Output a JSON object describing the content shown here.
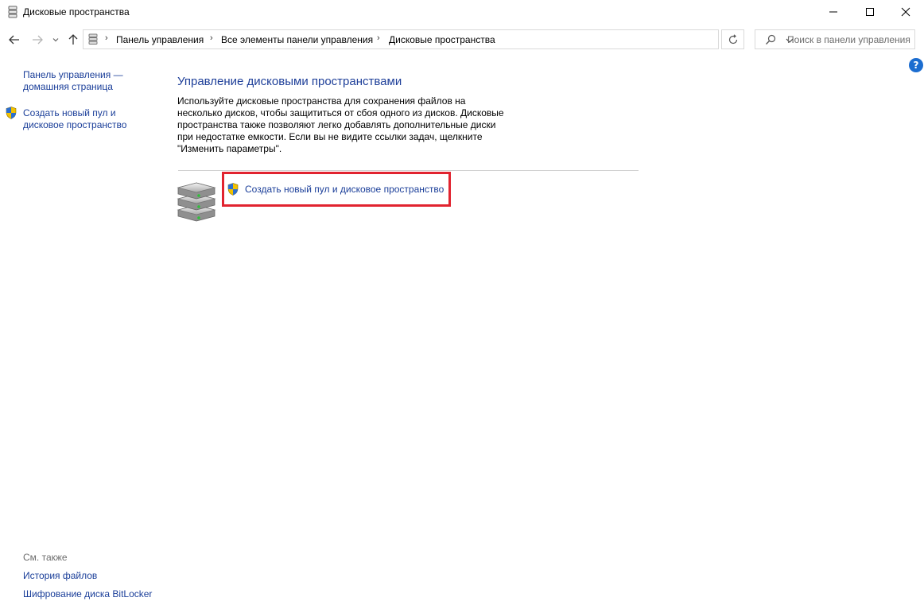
{
  "window": {
    "title": "Дисковые пространства",
    "app_icon": "storage-spaces-icon"
  },
  "address_bar": {
    "breadcrumbs": [
      "Панель управления",
      "Все элементы панели управления",
      "Дисковые пространства"
    ],
    "search_placeholder": "Поиск в панели управления"
  },
  "left_pane": {
    "home_link": "Панель управления — домашняя страница",
    "create_link": "Создать новый пул и дисковое пространство",
    "see_also_label": "См. также",
    "see_also_links": [
      "История файлов",
      "Шифрование диска BitLocker"
    ]
  },
  "main": {
    "title": "Управление дисковыми пространствами",
    "description": "Используйте дисковые пространства для сохранения файлов на несколько дисков, чтобы защититься от сбоя одного из дисков. Дисковые пространства также позволяют легко добавлять дополнительные диски при недостатке емкости. Если вы не видите ссылки задач, щелкните \"Изменить параметры\".",
    "task_link": "Создать новый пул и дисковое пространство"
  },
  "help_label": "?",
  "colors": {
    "link": "#1a3e99",
    "heading": "#1e3f99",
    "highlight": "#e1232f",
    "help": "#1c6dd0"
  }
}
